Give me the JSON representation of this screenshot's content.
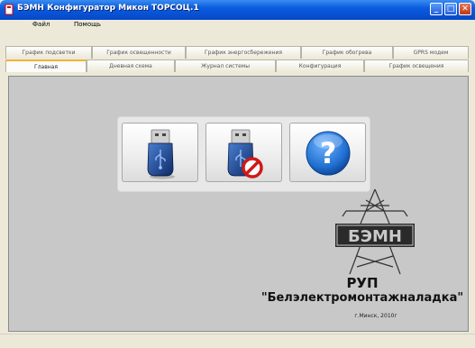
{
  "window": {
    "title": "БЭМН Конфигуратор Микон ТОРСОЦ.1",
    "controls": {
      "minimize": "_",
      "maximize": "□",
      "close": "✕"
    }
  },
  "menu": [
    "Файл",
    "Помощь"
  ],
  "tabs_row1": [
    "График подсветки",
    "График освещенности",
    "График энергосбережения",
    "График обогрева",
    "GPRS модем"
  ],
  "tabs_row2": [
    "Главная",
    "Дневная схема",
    "Журнал системы",
    "Конфигурация",
    "График освещения"
  ],
  "active_tab": "Главная",
  "buttons": [
    {
      "name": "connect-usb-button",
      "icon": "usb-flash-drive-icon"
    },
    {
      "name": "disconnect-usb-button",
      "icon": "usb-flash-drive-blocked-icon"
    },
    {
      "name": "help-button",
      "icon": "question-mark-icon"
    }
  ],
  "organization": {
    "logo_text": "БЭМН",
    "short_name": "РУП",
    "full_name": "\"Белэлектромонтажналадка\"",
    "city_year": "г.Минск, 2010г"
  },
  "colors": {
    "accent": "#f3b13a",
    "title_blue": "#0a5ce0",
    "close_red": "#c13713",
    "help_blue": "#1f6fd0",
    "usb_blue": "#2050a0"
  }
}
